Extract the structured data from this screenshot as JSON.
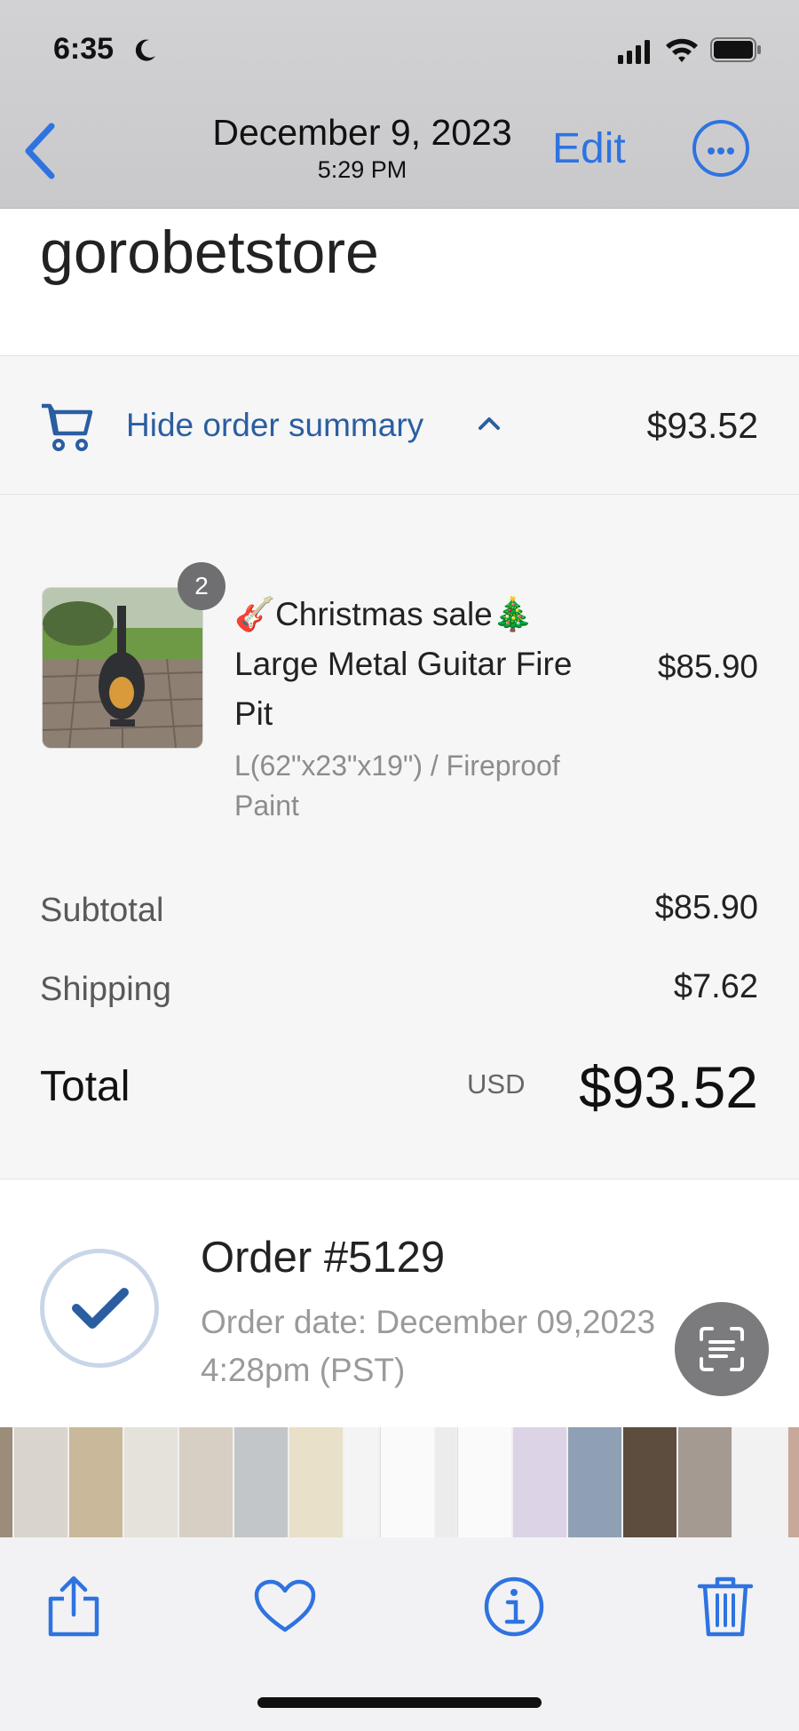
{
  "status_bar": {
    "time": "6:35"
  },
  "nav": {
    "date": "December 9, 2023",
    "time": "5:29 PM",
    "edit_label": "Edit"
  },
  "receipt": {
    "store_name": "gorobetstore",
    "summary_toggle_label": "Hide order summary",
    "summary_total": "$93.52",
    "item": {
      "quantity_badge": "2",
      "name": "🎸Christmas sale🎄 Large Metal Guitar Fire Pit",
      "variant": "L(62\"x23\"x19\") / Fireproof Paint",
      "price": "$85.90"
    },
    "subtotal_label": "Subtotal",
    "subtotal_value": "$85.90",
    "shipping_label": "Shipping",
    "shipping_value": "$7.62",
    "total_label": "Total",
    "currency": "USD",
    "total_value": "$93.52",
    "order_title": "Order  #5129",
    "order_date_line1": "Order date:  December 09,2023",
    "order_date_line2": "4:28pm (PST)"
  },
  "icons": {
    "back": "chevron-left-icon",
    "more": "ellipsis-circle-icon",
    "cart": "cart-icon",
    "caret": "chevron-up-icon",
    "check": "checkmark-circle-icon",
    "live_text": "live-text-scan-icon",
    "share": "share-icon",
    "favorite": "heart-icon",
    "info": "info-icon",
    "delete": "trash-icon"
  },
  "colors": {
    "ios_blue": "#2f73e0",
    "link_blue": "#2b5ea0",
    "badge_gray": "#6f6f72"
  }
}
